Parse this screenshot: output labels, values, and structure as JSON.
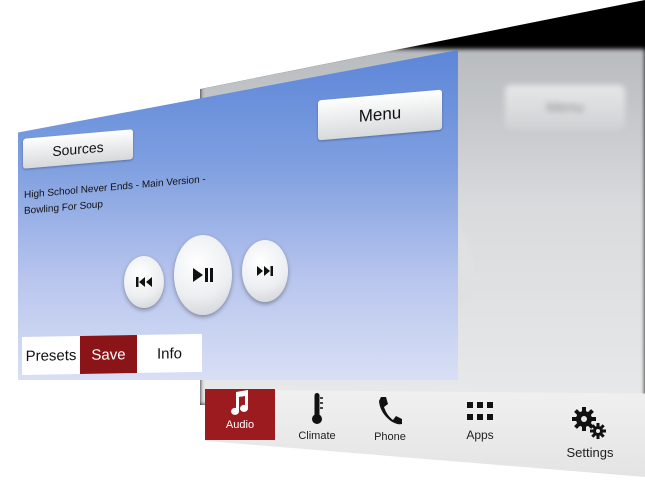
{
  "front": {
    "menu_label": "Menu",
    "sources_label": "Sources",
    "track_line1": "High School Never Ends - Main Version -",
    "track_line2": "Bowling For Soup",
    "controls": {
      "prev_icon": "previous-track-icon",
      "play_icon": "play-pause-icon",
      "next_icon": "next-track-icon"
    },
    "tabs": {
      "presets": "Presets",
      "save": "Save",
      "info": "Info"
    }
  },
  "back": {
    "menu_label": "Menu"
  },
  "nav": {
    "audio": "Audio",
    "climate": "Climate",
    "phone": "Phone",
    "apps": "Apps",
    "settings": "Settings"
  },
  "colors": {
    "accent_red": "#9b1b1e",
    "screen_blue": "#5c86d8"
  }
}
